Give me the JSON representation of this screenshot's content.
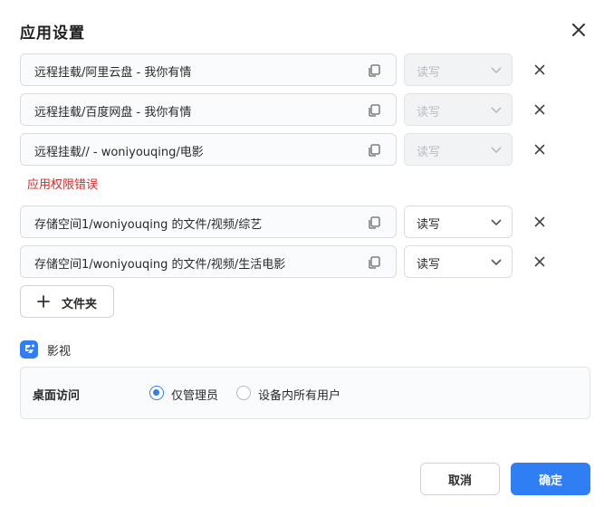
{
  "dialog": {
    "title": "应用设置"
  },
  "mounts": [
    {
      "path": "远程挂载/阿里云盘 - 我你有情",
      "permission": "读写",
      "disabled": true
    },
    {
      "path": "远程挂载/百度网盘 - 我你有情",
      "permission": "读写",
      "disabled": true
    },
    {
      "path": "远程挂载// - woniyouqing/电影",
      "permission": "读写",
      "disabled": true
    },
    {
      "path": "存储空间1/woniyouqing 的文件/视频/综艺",
      "permission": "读写",
      "disabled": false
    },
    {
      "path": "存储空间1/woniyouqing 的文件/视频/生活电影",
      "permission": "读写",
      "disabled": false
    }
  ],
  "error_text": "应用权限错误",
  "add_folder_label": "文件夹",
  "app": {
    "name": "影视",
    "icon": "video-app-icon"
  },
  "access": {
    "label": "桌面访问",
    "options": [
      "仅管理员",
      "设备内所有用户"
    ],
    "selected": 0
  },
  "footer": {
    "cancel_label": "取消",
    "ok_label": "确定"
  },
  "colors": {
    "accent": "#2f7ef3",
    "error": "#d62828"
  }
}
